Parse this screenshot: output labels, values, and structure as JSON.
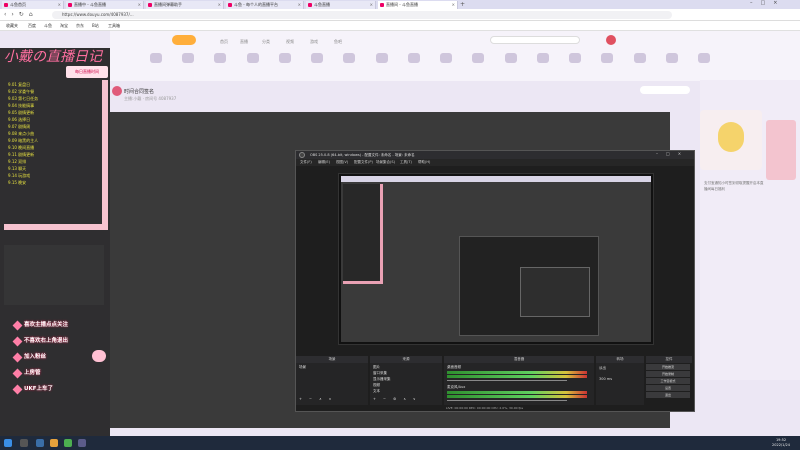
{
  "browser": {
    "tabs": [
      {
        "label": "斗鱼首页"
      },
      {
        "label": "直播中 - 斗鱼直播"
      },
      {
        "label": "直播间弹幕助手"
      },
      {
        "label": "斗鱼 - 每个人的直播平台"
      },
      {
        "label": "斗鱼直播"
      },
      {
        "label": "直播间 - 斗鱼直播"
      }
    ],
    "url": "https://www.douyu.com/4087937/...",
    "bookmarks": [
      "收藏夹",
      "百度",
      "斗鱼",
      "淘宝",
      "京东",
      "B站",
      "工具箱"
    ]
  },
  "site": {
    "nav": [
      "首页",
      "直播",
      "分类",
      "视频",
      "游戏",
      "鱼吧"
    ],
    "room_title": "时间合同签名",
    "room_sub": "主播:小戴 · 房间号 4087937",
    "ad_text": "支付宝通知小时签到领取提醒开启本直播间每日福利"
  },
  "overlay": {
    "title": "小戴の直播日记",
    "ribbon": "每日直播时间",
    "schedule": [
      "9.01 复盘日",
      "9.02 学委午餐",
      "9.03 第七日任务",
      "9.04 技能搞事",
      "9.05 剧情更新",
      "9.06 选择日",
      "9.07 剧情周",
      "9.08 来点小曲",
      "9.09 暗黑的主人",
      "9.10 晚间直播",
      "9.11 剧情更新",
      "9.12 双排",
      "9.13 聊天",
      "9.14 玩游戏",
      "9.15 晚安"
    ],
    "tips": [
      "喜欢主播点点关注",
      "不喜欢右上角退出",
      "加入粉丝",
      "上房管",
      "UKF上车了"
    ]
  },
  "obs": {
    "title": "OBS 25.0.8 (64-bit, windows) - 配置文件: 未命名 - 场景: 未命名",
    "menu": [
      "文件(F)",
      "编辑(E)",
      "视图(V)",
      "配置文件(P)",
      "场景集合(S)",
      "工具(T)",
      "帮助(H)"
    ],
    "panels": [
      "场景",
      "来源",
      "混音器",
      "转场",
      "控件"
    ],
    "scenes": [
      "场景"
    ],
    "sources": [
      "图片",
      "窗口采集",
      "显示器采集",
      "视频",
      "文本"
    ],
    "mixer": [
      "桌面音频",
      "麦克风/Aux"
    ],
    "transition": "淡出",
    "transition_ms": "300 ms",
    "controls": [
      "开始推流",
      "开始录制",
      "工作室模式",
      "设置",
      "退出"
    ],
    "status": "LIVE: 00:00:00  REC: 00:00:00  CPU: 2.0%, 30.00 fps"
  },
  "taskbar": {
    "time": "19:52",
    "date": "2022/1/24"
  }
}
